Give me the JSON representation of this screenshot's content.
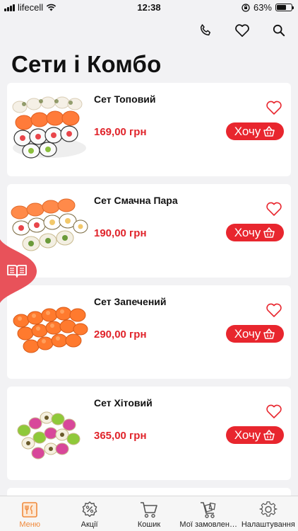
{
  "status": {
    "carrier": "lifecell",
    "time": "12:38",
    "battery_text": "63%",
    "battery_level": 0.63
  },
  "header": {
    "icons": [
      "phone-icon",
      "heart-icon",
      "search-icon"
    ]
  },
  "page": {
    "title": "Сети і Комбо"
  },
  "colors": {
    "accent": "#e8262e",
    "price": "#e0242b",
    "active_nav": "#f08a3c",
    "background": "#f2f2f4"
  },
  "products": [
    {
      "name": "Сет Топовий",
      "price": "169,00 грн",
      "button": "Хочу"
    },
    {
      "name": "Сет Смачна Пара",
      "price": "190,00 грн",
      "button": "Хочу"
    },
    {
      "name": "Сет Запечений",
      "price": "290,00 грн",
      "button": "Хочу"
    },
    {
      "name": "Сет Хітовий",
      "price": "365,00 грн",
      "button": "Хочу"
    }
  ],
  "nav": [
    {
      "label": "Меню",
      "icon": "menu-book-icon",
      "active": true
    },
    {
      "label": "Акції",
      "icon": "discount-icon",
      "active": false
    },
    {
      "label": "Кошик",
      "icon": "cart-icon",
      "active": false
    },
    {
      "label": "Мої замовлення",
      "icon": "orders-cart-icon",
      "active": false
    },
    {
      "label": "Налаштування",
      "icon": "settings-icon",
      "active": false
    }
  ]
}
